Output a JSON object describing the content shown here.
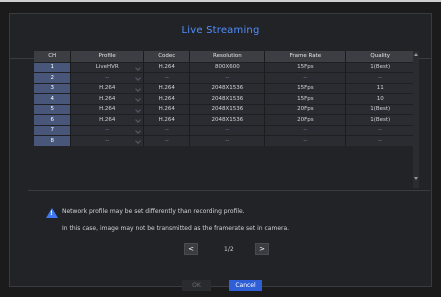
{
  "dialog": {
    "title": "Live Streaming"
  },
  "table": {
    "headers": [
      "CH",
      "Profile",
      "Codec",
      "Resolution",
      "Frame Rate",
      "Quality"
    ],
    "rows": [
      {
        "ch": "1",
        "profile": "LiveHVR",
        "codec": "H.264",
        "resolution": "800X600",
        "frame_rate": "15Fps",
        "quality": "1(Best)"
      },
      {
        "ch": "2",
        "profile": "--",
        "codec": "--",
        "resolution": "--",
        "frame_rate": "--",
        "quality": "--"
      },
      {
        "ch": "3",
        "profile": "H.264",
        "codec": "H.264",
        "resolution": "2048X1536",
        "frame_rate": "15Fps",
        "quality": "11"
      },
      {
        "ch": "4",
        "profile": "H.264",
        "codec": "H.264",
        "resolution": "2048X1536",
        "frame_rate": "15Fps",
        "quality": "10"
      },
      {
        "ch": "5",
        "profile": "H.264",
        "codec": "H.264",
        "resolution": "2048X1536",
        "frame_rate": "20Fps",
        "quality": "1(Best)"
      },
      {
        "ch": "6",
        "profile": "H.264",
        "codec": "H.264",
        "resolution": "2048X1536",
        "frame_rate": "20Fps",
        "quality": "1(Best)"
      },
      {
        "ch": "7",
        "profile": "--",
        "codec": "--",
        "resolution": "--",
        "frame_rate": "--",
        "quality": "--"
      },
      {
        "ch": "8",
        "profile": "--",
        "codec": "--",
        "resolution": "--",
        "frame_rate": "--",
        "quality": "--"
      }
    ]
  },
  "notice": {
    "line1": "Network profile may be set differently than recording profile.",
    "line2": "In this case, image may not be transmitted as the framerate set in camera."
  },
  "pagination": {
    "prev": "<",
    "next": ">",
    "page": "1/2"
  },
  "buttons": {
    "ok": "OK",
    "cancel": "Cancel"
  },
  "colors": {
    "accent": "#4f8fff",
    "cancel_button": "#2e5fd6",
    "warning_icon": "#3f78f0"
  },
  "icons": {
    "warning": "warning-icon",
    "dropdown": "chevron-down-icon"
  }
}
